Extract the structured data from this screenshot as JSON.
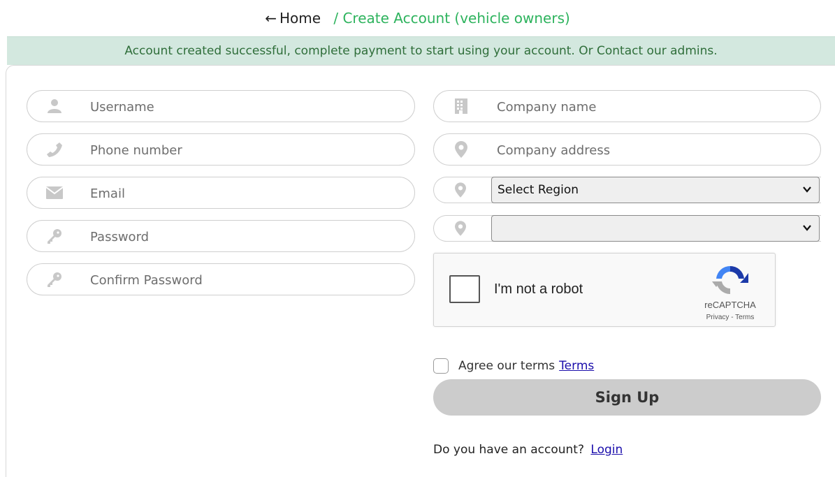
{
  "breadcrumb": {
    "back_arrow": "←",
    "home": "Home",
    "current": "/ Create Account (vehicle owners)"
  },
  "banner": {
    "message": "Account created successful, complete payment to start using your account. Or Contact our admins."
  },
  "form": {
    "left": [
      {
        "name": "username",
        "placeholder": "Username",
        "icon": "user-icon"
      },
      {
        "name": "phone",
        "placeholder": "Phone number",
        "icon": "phone-icon"
      },
      {
        "name": "email",
        "placeholder": "Email",
        "icon": "envelope-icon"
      },
      {
        "name": "password",
        "placeholder": "Password",
        "icon": "key-icon"
      },
      {
        "name": "confirm_password",
        "placeholder": "Confirm Password",
        "icon": "key-icon"
      }
    ],
    "right": [
      {
        "name": "company_name",
        "placeholder": "Company name",
        "icon": "building-icon"
      },
      {
        "name": "company_address",
        "placeholder": "Company address",
        "icon": "map-marker-icon"
      }
    ],
    "region_select": {
      "selected": "Select Region",
      "icon": "map-marker-icon"
    },
    "district_select": {
      "selected": "",
      "icon": "map-marker-icon"
    }
  },
  "captcha": {
    "label": "I'm not a robot",
    "brand": "reCAPTCHA",
    "links": "Privacy - Terms"
  },
  "agree": {
    "text": "Agree our terms",
    "link": "Terms"
  },
  "signup": {
    "label": "Sign Up"
  },
  "login": {
    "prompt": "Do you have an account?",
    "link": "Login"
  },
  "colors": {
    "accent_green": "#2db35d",
    "banner_bg": "#d3e8df",
    "banner_text": "#2f6e3a",
    "icon_gray": "#c8c8c8",
    "button_bg": "#cccccc",
    "link_blue": "#1a0dab"
  }
}
